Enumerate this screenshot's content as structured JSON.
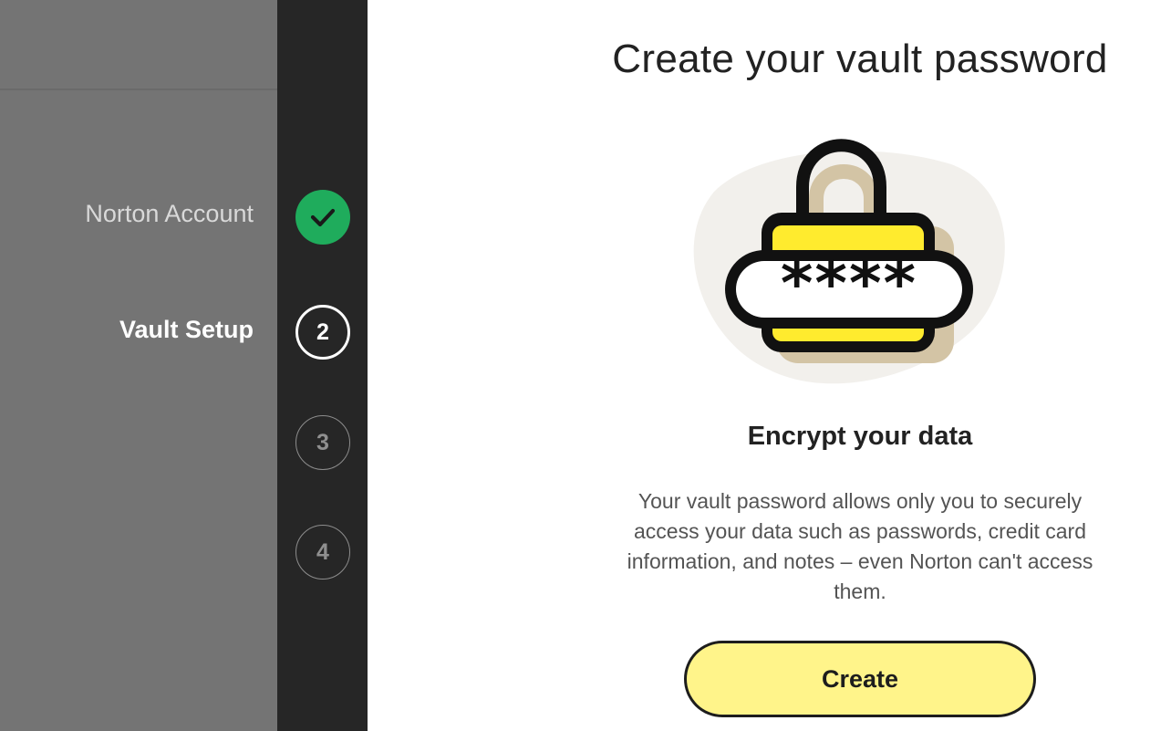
{
  "sidebar": {
    "steps": [
      {
        "label": "Norton Account",
        "state": "completed",
        "indicator": "check-icon"
      },
      {
        "label": "Vault Setup",
        "state": "active",
        "number": "2"
      },
      {
        "label": "",
        "state": "pending",
        "number": "3"
      },
      {
        "label": "",
        "state": "pending",
        "number": "4"
      }
    ]
  },
  "main": {
    "title": "Create your vault password",
    "illustration": {
      "name": "padlock-password-icon",
      "masked_text": "****"
    },
    "subtitle": "Encrypt your data",
    "description": "Your vault password allows only you to securely access your data such as passwords, credit card information, and notes – even Norton can't access them.",
    "create_button_label": "Create"
  },
  "colors": {
    "sidebar_bg": "#747474",
    "rail_bg": "#262626",
    "completed_green": "#1fac5c",
    "button_yellow": "#fff48a",
    "lock_yellow": "#ffeb2e",
    "lock_shadow": "#d3c4a5",
    "blob": "#f2f0ec"
  }
}
